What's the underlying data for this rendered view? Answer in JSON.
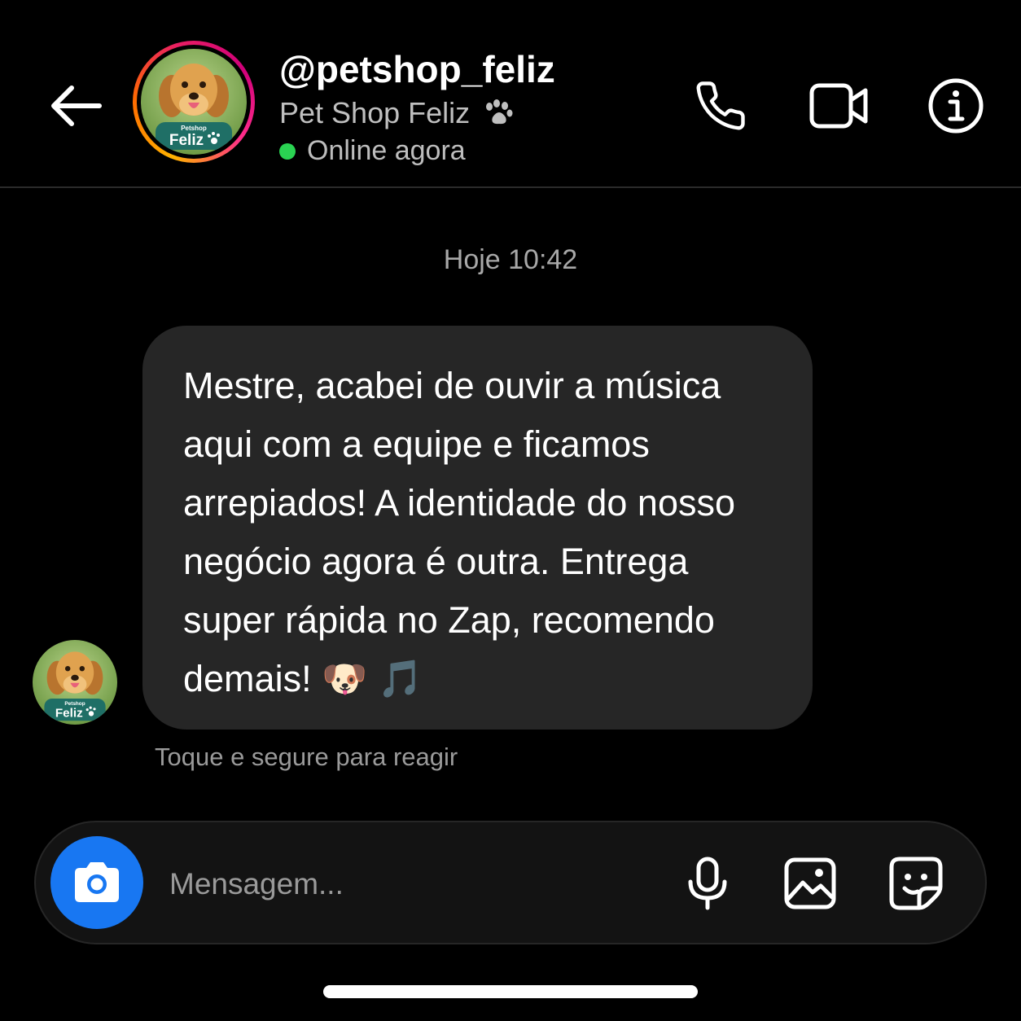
{
  "header": {
    "username": "@petshop_feliz",
    "display_name": "Pet Shop Feliz",
    "display_name_icon": "paw-icon",
    "status": "Online agora",
    "status_color": "#2ad352",
    "avatar_badge_text": "Feliz",
    "avatar_badge_subtext": "Petshop",
    "icons": [
      "back-arrow-icon",
      "phone-icon",
      "video-camera-icon",
      "info-icon"
    ]
  },
  "chat": {
    "timestamp": "Hoje 10:42",
    "message": {
      "text": "Mestre, acabei de ouvir a música\naqui com a equipe e ficamos\narrepiados! A identidade do nosso\nnegócio agora é outra. Entrega\nsuper rápida no Zap, recomendo\ndemais! 🐶 🎵",
      "bubble_color": "#262626"
    },
    "react_hint": "Toque e segure para reagir"
  },
  "composer": {
    "placeholder": "Mensagem...",
    "camera_button_color": "#1877f2",
    "icons": [
      "camera-icon",
      "microphone-icon",
      "gallery-icon",
      "sticker-icon"
    ]
  }
}
